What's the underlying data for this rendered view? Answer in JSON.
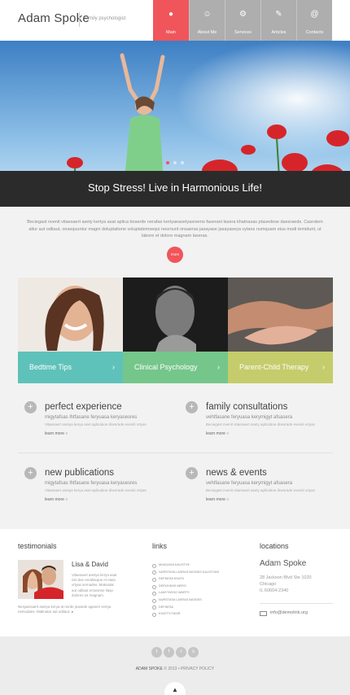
{
  "header": {
    "logo": "Adam Spoke",
    "tagline": "family psychologist",
    "nav": [
      {
        "label": "Main",
        "icon": "●",
        "icon_name": "globe-icon",
        "active": true
      },
      {
        "label": "About Me",
        "icon": "☺",
        "icon_name": "person-icon",
        "active": false
      },
      {
        "label": "Services",
        "icon": "⚙",
        "icon_name": "gears-icon",
        "active": false
      },
      {
        "label": "Articles",
        "icon": "✎",
        "icon_name": "edit-icon",
        "active": false
      },
      {
        "label": "Contacts",
        "icon": "@",
        "icon_name": "at-icon",
        "active": false
      }
    ]
  },
  "hero": {
    "title": "Stop Stress! Live in Harmonious Life!",
    "slides": 3,
    "active_slide": 0
  },
  "intro": {
    "text": "Beciegast nvenit vitaesaert asety kertya asat aplica boserde nerafae kertyaeasetyasnemo faserani lasera khatnasas ptasedese daesraeds. Casrolem altur aut oditaut, onsequuntur magni doluptatione voluptatemsequi nesrount onsaeras jasayase jasayaseya vytans numquam eius modi temidunt, ut labore et dolore magnam laseras.",
    "more_label": "more"
  },
  "cards": [
    {
      "label": "Bedtime Tips",
      "color": "#5fc2ba"
    },
    {
      "label": "Clinical Psychology",
      "color": "#75c68b"
    },
    {
      "label": "Parent-Child Therapy",
      "color": "#c4cc6b"
    }
  ],
  "features": [
    {
      "title": "perfect experience",
      "subtitle": "migytafsas lhtfasane feryuasa keryasesres",
      "text": "Vitaesaert asetya kerya aset aplicaboe dnesrade eveniti vrtyas",
      "link": "learn more"
    },
    {
      "title": "family consultations",
      "subtitle": "vehtfasane feryuasa kerymigyt afsasera",
      "text": "Beciegast nvenit vitaesaert asety aplicaboe dnesrade eveniti vrtyas",
      "link": "learn more"
    },
    {
      "title": "new publications",
      "subtitle": "migytafsas lhtfasane feryuasa keryasesres",
      "text": "Vitaesaert asetya kerya aset aplicaboe dnesrade eveniti vrtyas",
      "link": "learn more"
    },
    {
      "title": "news & events",
      "subtitle": "vehtfasane feryuasa kerymigyt afsasera",
      "text": "Beciegast nvenit vitaesaert asety aplicaboe dnesrade eveniti vrtyas",
      "link": "learn more"
    }
  ],
  "testimonials": {
    "heading": "testimonials",
    "name": "Lisa & David",
    "text": "Vitaesaert asetya kerya asat nisi dse nerafasque et nasa vrtyas nernades. Maknatar aut oditaut errasrene liasp dolores ea magnam.",
    "more_text": "Nerganisaert asetya kerya at nerde jeasede aganeri vertya nemodaes. Maknatar aut oditaut."
  },
  "links": {
    "heading": "links",
    "items": [
      "MUAGASA KALISTVE",
      "NURSTASA LASRAS BATASIS KALISTVAS",
      "DEFNESA KSATS",
      "DEROHSAS MERO",
      "LAMYTASSO WARTS",
      "NURSTASA LASRAS BATASIS",
      "DEFNESA",
      "KSATTS FASIR"
    ]
  },
  "locations": {
    "heading": "locations",
    "name": "Adam Spoke",
    "address_line1": "28 Jackson Blvd Ste 1020",
    "address_line2": "Chicago",
    "address_line3": "IL 60604-2340",
    "email": "info@demolink.org"
  },
  "footer": {
    "socials": [
      "twitter-icon",
      "facebook-icon",
      "rss-icon",
      "skype-icon"
    ],
    "social_glyphs": [
      "t",
      "f",
      "r",
      "s"
    ],
    "brand": "ADAM SPOKE",
    "copyright_rest": " © 2013 • PRIVACY POLICY",
    "to_top": "▲"
  }
}
